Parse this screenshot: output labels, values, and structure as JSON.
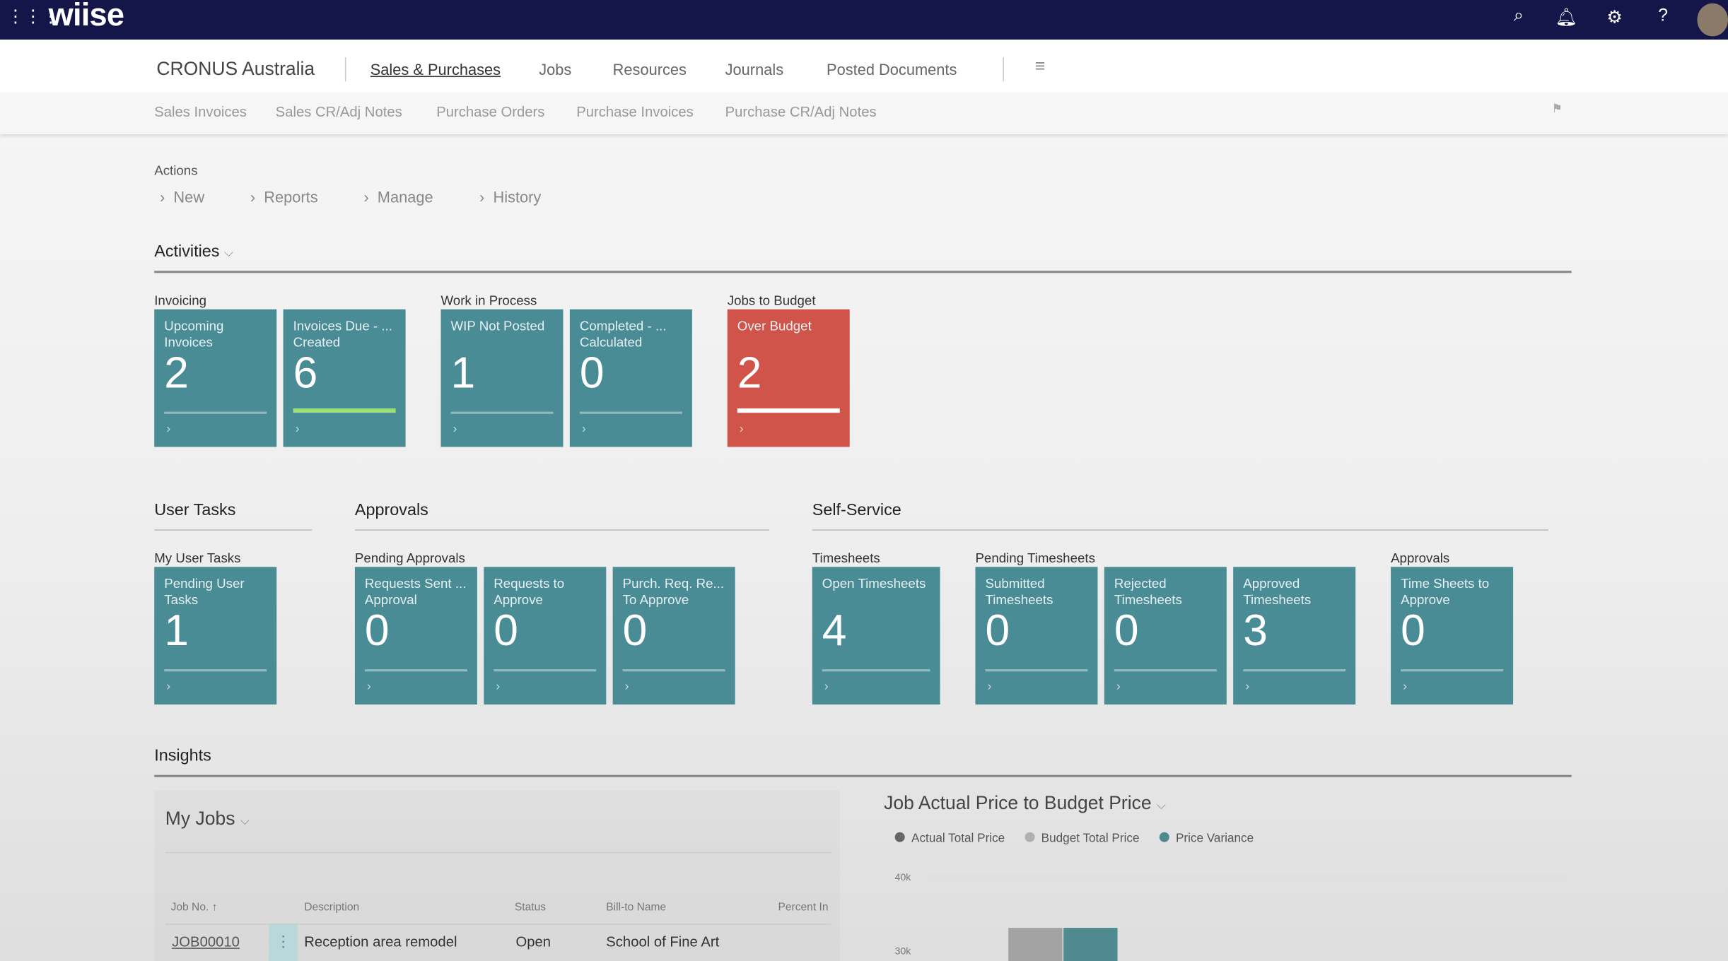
{
  "app": {
    "logo": "wiise",
    "icons": [
      "waffle-icon",
      "search-icon",
      "bell-icon",
      "gear-icon",
      "help-icon",
      "avatar"
    ]
  },
  "nav": {
    "company": "CRONUS Australia",
    "items": [
      "Sales & Purchases",
      "Jobs",
      "Resources",
      "Journals",
      "Posted Documents"
    ],
    "active": "Sales & Purchases"
  },
  "subnav": [
    "Sales Invoices",
    "Sales CR/Adj Notes",
    "Purchase Orders",
    "Purchase Invoices",
    "Purchase CR/Adj Notes"
  ],
  "actions": {
    "title": "Actions",
    "items": [
      "New",
      "Reports",
      "Manage",
      "History"
    ]
  },
  "activities": {
    "title": "Activities",
    "groups": [
      {
        "label": "Invoicing",
        "tiles": [
          {
            "title": "Upcoming Invoices",
            "value": "2"
          },
          {
            "title": "Invoices Due - ... Created",
            "value": "6",
            "bar_color": "#9be07a"
          }
        ]
      },
      {
        "label": "Work in Process",
        "tiles": [
          {
            "title": "WIP Not Posted",
            "value": "1"
          },
          {
            "title": "Completed - ... Calculated",
            "value": "0"
          }
        ]
      },
      {
        "label": "Jobs to Budget",
        "tiles": [
          {
            "title": "Over Budget",
            "value": "2",
            "color": "#d0544a",
            "bar_color": "#ffffff"
          }
        ]
      }
    ]
  },
  "user_tasks": {
    "title": "User Tasks",
    "groups": [
      {
        "label": "My User Tasks",
        "tiles": [
          {
            "title": "Pending User Tasks",
            "value": "1"
          }
        ]
      }
    ]
  },
  "approvals": {
    "title": "Approvals",
    "groups": [
      {
        "label": "Pending Approvals",
        "tiles": [
          {
            "title": "Requests Sent ... Approval",
            "value": "0"
          },
          {
            "title": "Requests to Approve",
            "value": "0"
          },
          {
            "title": "Purch. Req. Re... To Approve",
            "value": "0"
          }
        ]
      }
    ]
  },
  "self_service": {
    "title": "Self-Service",
    "groups": [
      {
        "label": "Timesheets",
        "tiles": [
          {
            "title": "Open Timesheets",
            "value": "4"
          }
        ]
      },
      {
        "label": "Pending Timesheets",
        "tiles": [
          {
            "title": "Submitted Timesheets",
            "value": "0"
          },
          {
            "title": "Rejected Timesheets",
            "value": "0"
          },
          {
            "title": "Approved Timesheets",
            "value": "3"
          }
        ]
      },
      {
        "label": "Approvals",
        "tiles": [
          {
            "title": "Time Sheets to Approve",
            "value": "0"
          }
        ]
      }
    ]
  },
  "insights": {
    "title": "Insights",
    "my_jobs": {
      "title": "My Jobs",
      "columns": [
        "Job No. ↑",
        "Description",
        "Status",
        "Bill-to Name",
        "Percent In"
      ],
      "rows": [
        {
          "job_no": "JOB00010",
          "description": "Reception area remodel",
          "status": "Open",
          "bill_to": "School of Fine Art"
        }
      ]
    }
  },
  "chart_data": {
    "type": "bar",
    "title": "Job Actual Price to Budget Price",
    "legend": [
      {
        "name": "Actual Total Price",
        "color": "#666666"
      },
      {
        "name": "Budget Total Price",
        "color": "#b0b0b0"
      },
      {
        "name": "Price Variance",
        "color": "#4f8a90"
      }
    ],
    "legend_position": "top-left",
    "y_ticks": [
      "40k",
      "30k"
    ],
    "grid": true,
    "series": [
      {
        "name": "Budget Total Price",
        "values": [
          33000
        ]
      },
      {
        "name": "Price Variance",
        "values": [
          33000
        ]
      }
    ]
  }
}
